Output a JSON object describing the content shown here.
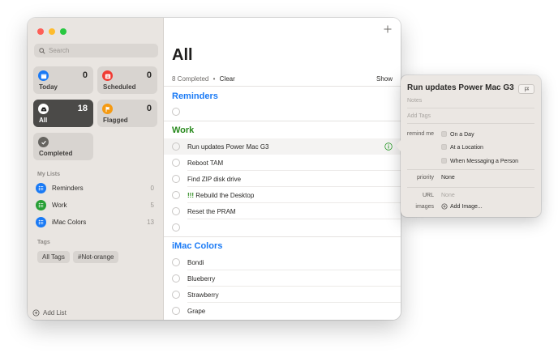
{
  "sidebar": {
    "search_placeholder": "Search",
    "smart_lists": [
      {
        "label": "Today",
        "count": "0",
        "color": "#1a7af5",
        "icon": "calendar-icon"
      },
      {
        "label": "Scheduled",
        "count": "0",
        "color": "#f03c34",
        "icon": "calendar-clock-icon"
      },
      {
        "label": "All",
        "count": "18",
        "color": "#1e1e1e",
        "icon": "tray-icon",
        "selected": true
      },
      {
        "label": "Flagged",
        "count": "0",
        "color": "#f59a12",
        "icon": "flag-icon"
      },
      {
        "label": "Completed",
        "count": "",
        "color": "#666460",
        "icon": "checkmark-icon"
      }
    ],
    "my_lists_title": "My Lists",
    "lists": [
      {
        "name": "Reminders",
        "count": "0",
        "color": "#1a7af5",
        "icon": "list-bullet-icon"
      },
      {
        "name": "Work",
        "count": "5",
        "color": "#28a036",
        "icon": "list-bullet-icon"
      },
      {
        "name": "iMac Colors",
        "count": "13",
        "color": "#1a7af5",
        "icon": "list-bullet-icon"
      }
    ],
    "tags_title": "Tags",
    "tags": [
      "All Tags",
      "#Not-orange"
    ],
    "add_list_label": "Add List"
  },
  "main": {
    "title": "All",
    "completed_text": "8 Completed",
    "separator": "•",
    "clear_label": "Clear",
    "show_label": "Show",
    "groups": [
      {
        "title": "Reminders",
        "color": "#1a7af5",
        "items": []
      },
      {
        "title": "Work",
        "color": "#27891c",
        "items": [
          {
            "text": "Run updates Power Mac G3",
            "selected": true
          },
          {
            "text": "Reboot TAM"
          },
          {
            "text": "Find ZIP disk drive"
          },
          {
            "priority": "!!!",
            "text": "Rebuild the Desktop"
          },
          {
            "text": "Reset the PRAM"
          }
        ]
      },
      {
        "title": "iMac Colors",
        "color": "#1a7af5",
        "items": [
          {
            "text": "Bondi"
          },
          {
            "text": "Blueberry"
          },
          {
            "text": "Strawberry"
          },
          {
            "text": "Grape"
          }
        ]
      }
    ]
  },
  "detail": {
    "title": "Run updates Power Mac G3",
    "notes_placeholder": "Notes",
    "tags_placeholder": "Add Tags",
    "remind_me_label": "remind me",
    "remind_options": [
      "On a Day",
      "At a Location",
      "When Messaging a Person"
    ],
    "priority_label": "priority",
    "priority_value": "None",
    "url_label": "URL",
    "url_value": "None",
    "images_label": "images",
    "add_image_label": "Add Image..."
  }
}
